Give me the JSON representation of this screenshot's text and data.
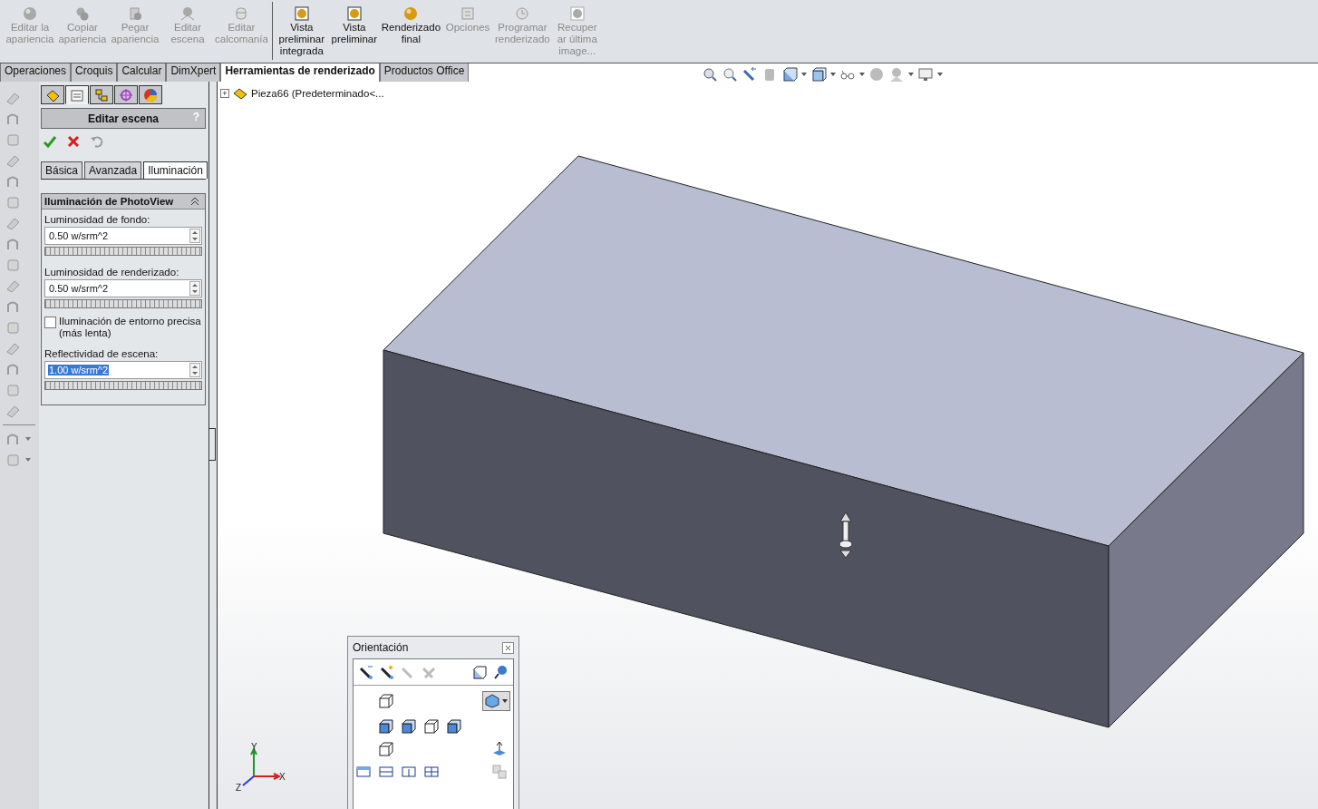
{
  "ribbon": {
    "buttons": [
      {
        "label": "Editar la\napariencia",
        "disabled": true
      },
      {
        "label": "Copiar\napariencia",
        "disabled": true
      },
      {
        "label": "Pegar\napariencia",
        "disabled": true
      },
      {
        "label": "Editar\nescena",
        "disabled": true
      },
      {
        "label": "Editar\ncalcomanía",
        "disabled": true
      },
      {
        "label": "Vista\npreliminar\nintegrada",
        "disabled": false
      },
      {
        "label": "Vista\npreliminar",
        "disabled": false
      },
      {
        "label": "Renderizado\nfinal",
        "disabled": false
      },
      {
        "label": "Opciones",
        "disabled": true
      },
      {
        "label": "Programar\nrenderizado",
        "disabled": true
      },
      {
        "label": "Recuper\nar última\nimage...",
        "disabled": true
      }
    ]
  },
  "command_tabs": [
    {
      "label": "Operaciones",
      "selected": false
    },
    {
      "label": "Croquis",
      "selected": false
    },
    {
      "label": "Calcular",
      "selected": false
    },
    {
      "label": "DimXpert",
      "selected": false
    },
    {
      "label": "Herramientas de renderizado",
      "selected": true
    },
    {
      "label": "Productos Office",
      "selected": false
    }
  ],
  "panel": {
    "tabs": [
      {
        "selected": false
      },
      {
        "selected": true
      },
      {
        "selected": false
      },
      {
        "selected": false
      },
      {
        "selected": false
      }
    ],
    "title": "Editar escena",
    "help": "?",
    "scene_tabs": [
      {
        "label": "Básica",
        "selected": false
      },
      {
        "label": "Avanzada",
        "selected": false
      },
      {
        "label": "Iluminación",
        "selected": true
      }
    ],
    "section": {
      "title": "Iluminación de PhotoView",
      "expanded": true,
      "items": [
        {
          "kind": "spin",
          "label": "Luminosidad de fondo:",
          "value": "0.50 w/srm^2",
          "highlighted": false
        },
        {
          "kind": "spin",
          "label": "Luminosidad de renderizado:",
          "value": "0.50 w/srm^2",
          "highlighted": false
        },
        {
          "kind": "check",
          "label": "Iluminación de entorno precisa (más lenta)",
          "checked": false
        },
        {
          "kind": "spin",
          "label": "Reflectividad de escena:",
          "value": "1.00 w/srm^2",
          "highlighted": true
        }
      ]
    }
  },
  "tree": {
    "root": "Pieza66  (Predeterminado<...",
    "expand": "+"
  },
  "orientation": {
    "title": "Orientación"
  },
  "triad": {
    "x": "X",
    "y": "Y",
    "z": "Z"
  }
}
